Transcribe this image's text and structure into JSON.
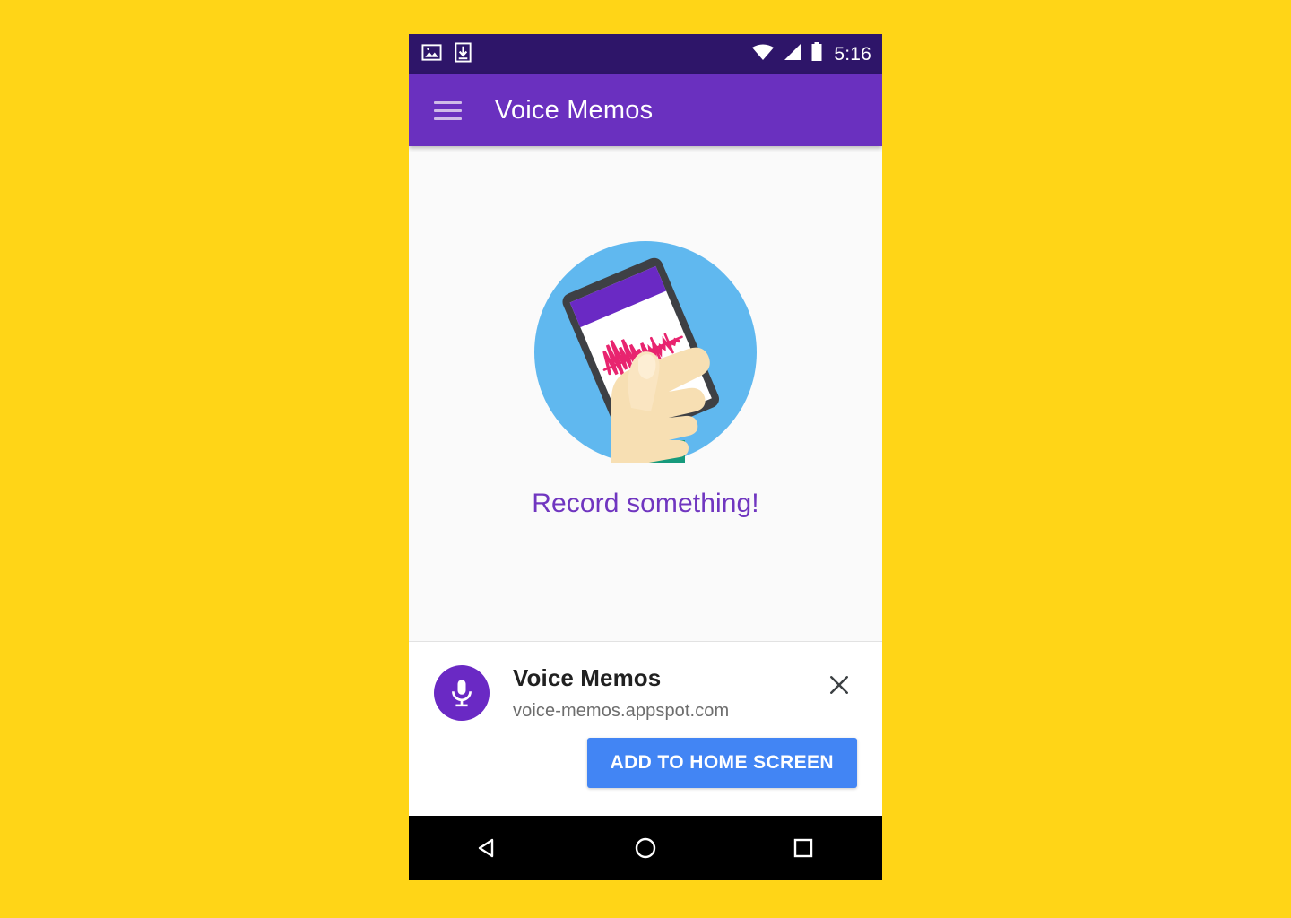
{
  "background_color": "#ffd517",
  "status_bar": {
    "background": "#2e1569",
    "time": "5:16",
    "left_icons": [
      "image-icon",
      "download-icon"
    ],
    "right_icons": [
      "wifi-icon",
      "cellular-signal-icon",
      "battery-icon"
    ]
  },
  "app_bar": {
    "background": "#6a30bf",
    "menu_icon": "hamburger-menu-icon",
    "title": "Voice Memos"
  },
  "content": {
    "background": "#fafafa",
    "illustration": "hand-holding-phone-recording-illustration",
    "illustration_colors": {
      "circle": "#60b8ef",
      "phone_body": "#3e4044",
      "phone_screen": "#ffffff",
      "phone_header": "#6a29c4",
      "waveform": "#e8246f",
      "skin": "#f7dfb3",
      "sleeve": "#169a7c"
    },
    "empty_state_text": "Record something!",
    "empty_state_text_color": "#7036c0"
  },
  "install_banner": {
    "app_icon": "microphone-icon",
    "app_icon_background": "#6a29c4",
    "app_name": "Voice Memos",
    "url": "voice-memos.appspot.com",
    "close_icon": "close-icon",
    "button_label": "ADD TO HOME SCREEN",
    "button_color": "#4285f4"
  },
  "nav_bar": {
    "background": "#000000",
    "buttons": [
      {
        "name": "back-button",
        "icon": "triangle-left-icon"
      },
      {
        "name": "home-button",
        "icon": "circle-icon"
      },
      {
        "name": "recents-button",
        "icon": "square-icon"
      }
    ]
  }
}
